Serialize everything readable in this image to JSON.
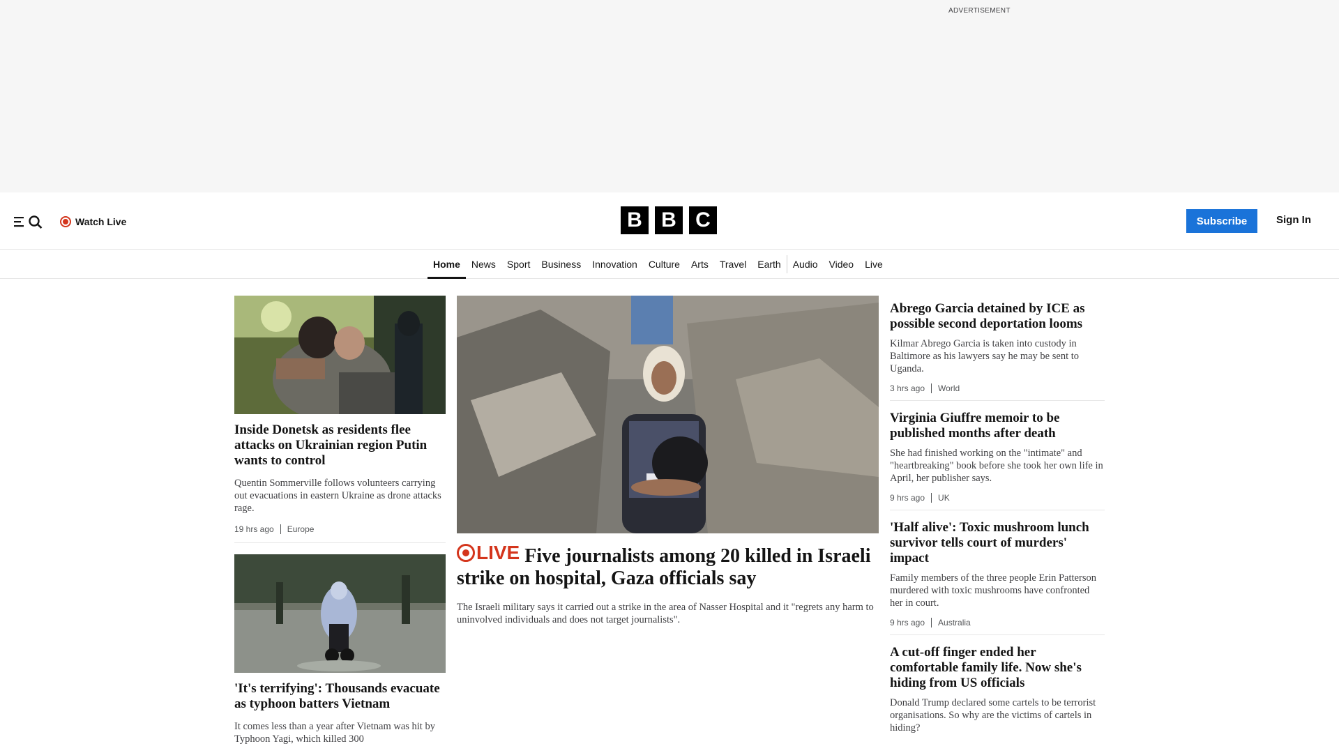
{
  "ad": {
    "label": "ADVERTISEMENT"
  },
  "masthead": {
    "menu_icon": "menu-icon",
    "search_icon": "search-icon",
    "watch_live": "Watch Live",
    "logo_letters": [
      "B",
      "B",
      "C"
    ],
    "subscribe": "Subscribe",
    "sign_in": "Sign In"
  },
  "nav": {
    "items": [
      {
        "label": "Home",
        "active": true
      },
      {
        "label": "News"
      },
      {
        "label": "Sport"
      },
      {
        "label": "Business"
      },
      {
        "label": "Innovation"
      },
      {
        "label": "Culture"
      },
      {
        "label": "Arts"
      },
      {
        "label": "Travel"
      },
      {
        "label": "Earth"
      },
      {
        "label": "Audio"
      },
      {
        "label": "Video"
      },
      {
        "label": "Live"
      }
    ]
  },
  "left": {
    "stories": [
      {
        "headline": "Inside Donetsk as residents flee attacks on Ukrainian region Putin wants to control",
        "summary": "Quentin Sommerville follows volunteers carrying out evacuations in eastern Ukraine as drone attacks rage.",
        "time": "19 hrs ago",
        "tag": "Europe"
      },
      {
        "headline": "'It's terrifying': Thousands evacuate as typhoon batters Vietnam",
        "summary": "It comes less than a year after Vietnam was hit by Typhoon Yagi, which killed 300"
      }
    ]
  },
  "hero": {
    "live_label": "LIVE",
    "headline": "Five journalists among 20 killed in Israeli strike on hospital, Gaza officials say",
    "summary": "The Israeli military says it carried out a strike in the area of Nasser Hospital and it \"regrets any harm to uninvolved individuals and does not target journalists\"."
  },
  "right": {
    "stories": [
      {
        "headline": "Abrego Garcia detained by ICE as possible second deportation looms",
        "summary": "Kilmar Abrego Garcia is taken into custody in Baltimore as his lawyers say he may be sent to Uganda.",
        "time": "3 hrs ago",
        "tag": "World"
      },
      {
        "headline": "Virginia Giuffre memoir to be published months after death",
        "summary": "She had finished working on the \"intimate\" and \"heartbreaking\" book before she took her own life in April, her publisher says.",
        "time": "9 hrs ago",
        "tag": "UK"
      },
      {
        "headline": "'Half alive': Toxic mushroom lunch survivor tells court of murders' impact",
        "summary": "Family members of the three people Erin Patterson murdered with toxic mushrooms have confronted her in court.",
        "time": "9 hrs ago",
        "tag": "Australia"
      },
      {
        "headline": "A cut-off finger ended her comfortable family life. Now she's hiding from US officials",
        "summary": "Donald Trump declared some cartels to be terrorist organisations. So why are the victims of cartels in hiding?"
      }
    ]
  },
  "colors": {
    "live_red": "#d4351c",
    "subscribe_blue": "#1a73d9",
    "logo_black": "#000000"
  }
}
